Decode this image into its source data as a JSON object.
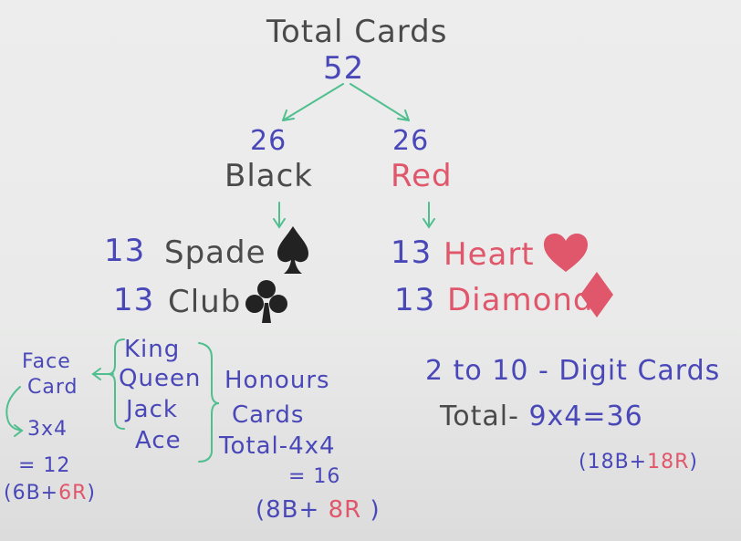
{
  "title": "Total Cards",
  "total": "52",
  "black": {
    "count": "26",
    "label": "Black"
  },
  "red": {
    "count": "26",
    "label": "Red"
  },
  "suits": {
    "spade": {
      "count": "13",
      "label": "Spade",
      "icon": "spade-icon"
    },
    "club": {
      "count": "13",
      "label": "Club",
      "icon": "club-icon"
    },
    "heart": {
      "count": "13",
      "label": "Heart",
      "icon": "heart-icon"
    },
    "diamond": {
      "count": "13",
      "label": "Diamond",
      "icon": "diamond-icon"
    }
  },
  "face": {
    "line1": "Face",
    "line2": "Card",
    "calc": "3x4",
    "result": "= 12",
    "split_open": "(6B+",
    "split_red": "6R",
    "split_close": ")"
  },
  "ranks": [
    "King",
    "Queen",
    "Jack",
    "Ace"
  ],
  "honours": {
    "line1": "Honours",
    "line2": "Cards",
    "calc": "Total-4x4",
    "result": "= 16",
    "split_open": "(8B+ ",
    "split_red": "8R",
    "split_close": " )"
  },
  "digit": {
    "title": "2 to 10 - Digit Cards",
    "calc_label": "Total-",
    "calc": "9x4=36",
    "split_open": "(18B+",
    "split_red": "18R",
    "split_close": ")"
  },
  "colors": {
    "blue": "#4a48b8",
    "gray": "#4a4a4a",
    "red": "#e0566b",
    "green": "#4fbf8f",
    "black": "#222222"
  }
}
